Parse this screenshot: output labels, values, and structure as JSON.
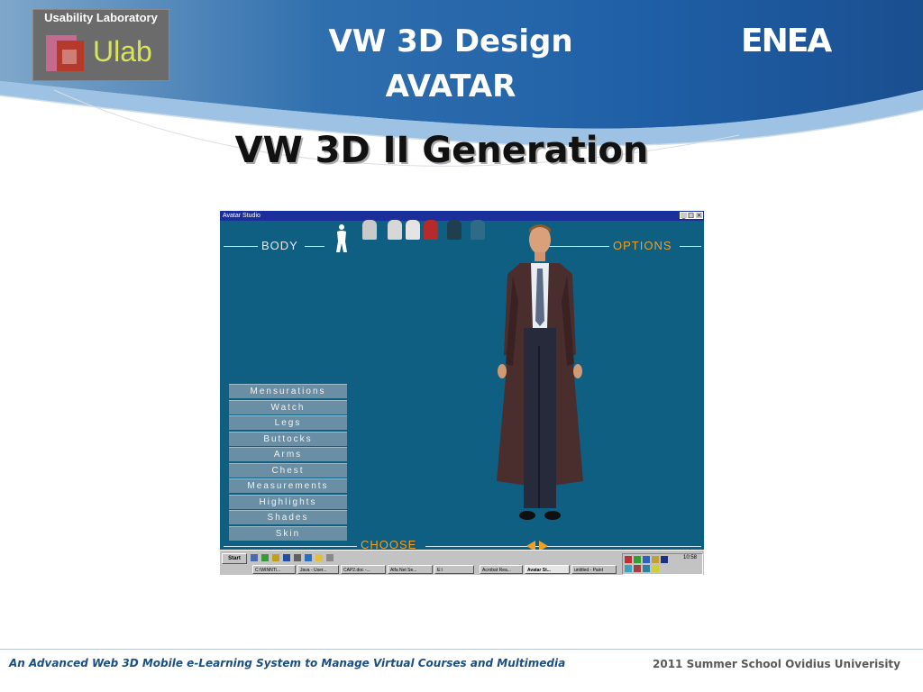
{
  "slide": {
    "title_line1": "VW 3D Design",
    "title_line2": "AVATAR",
    "subtitle": "VW 3D II Generation",
    "logo_left_caption": "Usability Laboratory",
    "logo_left_word": "Ulab",
    "logo_right": "ENEA",
    "footer_left": "An Advanced Web 3D Mobile e-Learning System to Manage  Virtual Courses and Multimedia",
    "footer_right": "2011 Summer School Ovidius Univerisity"
  },
  "colors": {
    "header_blue": "#1f6bb0",
    "app_bg": "#0f5f82",
    "accent_orange": "#f0a022",
    "menu_button": "#6a8fa4",
    "footer_text": "#1a4f86"
  },
  "app": {
    "window_title": "Avatar Studio",
    "label_body": "BODY",
    "label_options": "OPTIONS",
    "label_choose": "CHOOSE",
    "menu": [
      "Mensurations",
      "Watch",
      "Legs",
      "Buttocks",
      "Arms",
      "Chest",
      "Measurements",
      "Highlights",
      "Shades",
      "Skin"
    ],
    "taskbar": {
      "start_label": "Start",
      "clock": "10:58",
      "buttons": [
        "C:\\WINNT\\...",
        "Java - User...",
        "CAP2.doc -...",
        "Alfa Net Se...",
        "E:\\",
        "Acrobat Rea...",
        "Avatar St...",
        "untitled - Paint"
      ]
    }
  }
}
